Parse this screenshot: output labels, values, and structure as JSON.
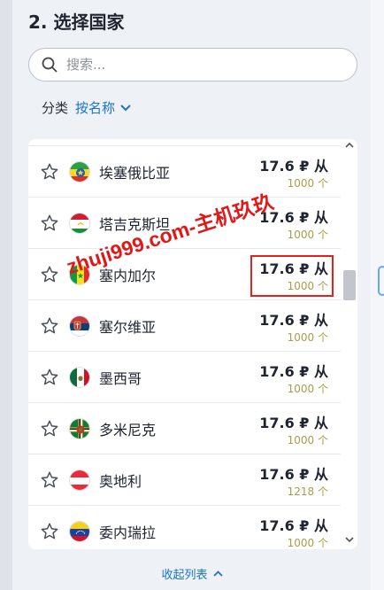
{
  "section": {
    "title": "2. 选择国家"
  },
  "search": {
    "placeholder": "搜索..."
  },
  "sort": {
    "label": "分类",
    "value": "按名称"
  },
  "countries": [
    {
      "name": "埃塞俄比亚",
      "price": "17.6 ₽ 从",
      "qty": "1000 个",
      "flag": "ethiopia"
    },
    {
      "name": "塔吉克斯坦",
      "price": "17.6 ₽ 从",
      "qty": "1000 个",
      "flag": "tajikistan"
    },
    {
      "name": "塞内加尔",
      "price": "17.6 ₽ 从",
      "qty": "1000 个",
      "flag": "senegal"
    },
    {
      "name": "塞尔维亚",
      "price": "17.6 ₽ 从",
      "qty": "1000 个",
      "flag": "serbia"
    },
    {
      "name": "墨西哥",
      "price": "17.6 ₽ 从",
      "qty": "1000 个",
      "flag": "mexico"
    },
    {
      "name": "多米尼克",
      "price": "17.6 ₽ 从",
      "qty": "1000 个",
      "flag": "dominica"
    },
    {
      "name": "奥地利",
      "price": "17.6 ₽ 从",
      "qty": "1218 个",
      "flag": "austria"
    },
    {
      "name": "委内瑞拉",
      "price": "17.6 ₽ 从",
      "qty": "1000 个",
      "flag": "venezuela"
    }
  ],
  "scrollbar": {
    "position": 0.33
  },
  "collapse": {
    "label": "收起列表"
  },
  "watermark": {
    "text": "zhuji999.com-主机玖玖"
  },
  "colors": {
    "accent": "#1a73c9",
    "qty": "#a79d49",
    "highlight": "#e0241d"
  }
}
